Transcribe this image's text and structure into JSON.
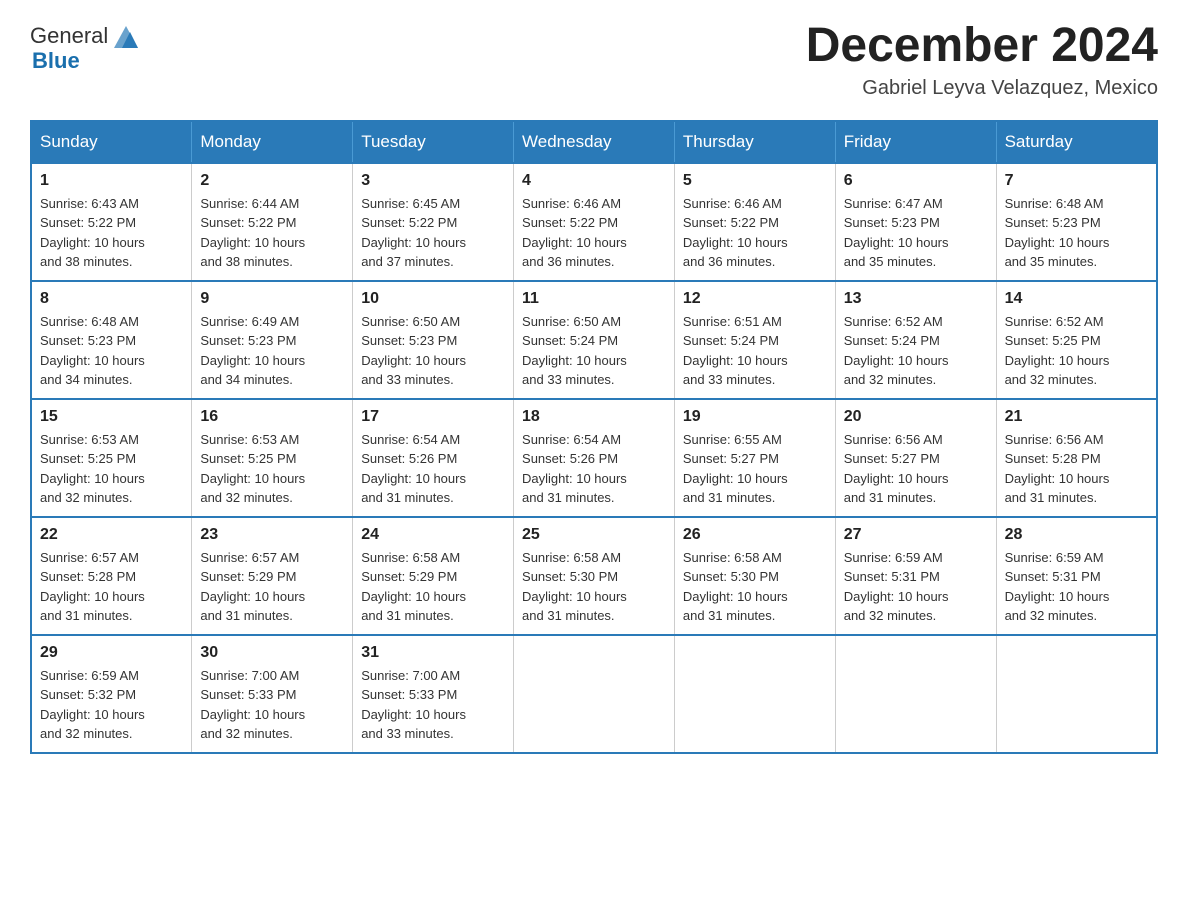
{
  "header": {
    "logo_text": "General",
    "logo_blue": "Blue",
    "month_year": "December 2024",
    "location": "Gabriel Leyva Velazquez, Mexico"
  },
  "weekdays": [
    "Sunday",
    "Monday",
    "Tuesday",
    "Wednesday",
    "Thursday",
    "Friday",
    "Saturday"
  ],
  "weeks": [
    [
      {
        "day": "1",
        "sunrise": "6:43 AM",
        "sunset": "5:22 PM",
        "daylight": "10 hours and 38 minutes."
      },
      {
        "day": "2",
        "sunrise": "6:44 AM",
        "sunset": "5:22 PM",
        "daylight": "10 hours and 38 minutes."
      },
      {
        "day": "3",
        "sunrise": "6:45 AM",
        "sunset": "5:22 PM",
        "daylight": "10 hours and 37 minutes."
      },
      {
        "day": "4",
        "sunrise": "6:46 AM",
        "sunset": "5:22 PM",
        "daylight": "10 hours and 36 minutes."
      },
      {
        "day": "5",
        "sunrise": "6:46 AM",
        "sunset": "5:22 PM",
        "daylight": "10 hours and 36 minutes."
      },
      {
        "day": "6",
        "sunrise": "6:47 AM",
        "sunset": "5:23 PM",
        "daylight": "10 hours and 35 minutes."
      },
      {
        "day": "7",
        "sunrise": "6:48 AM",
        "sunset": "5:23 PM",
        "daylight": "10 hours and 35 minutes."
      }
    ],
    [
      {
        "day": "8",
        "sunrise": "6:48 AM",
        "sunset": "5:23 PM",
        "daylight": "10 hours and 34 minutes."
      },
      {
        "day": "9",
        "sunrise": "6:49 AM",
        "sunset": "5:23 PM",
        "daylight": "10 hours and 34 minutes."
      },
      {
        "day": "10",
        "sunrise": "6:50 AM",
        "sunset": "5:23 PM",
        "daylight": "10 hours and 33 minutes."
      },
      {
        "day": "11",
        "sunrise": "6:50 AM",
        "sunset": "5:24 PM",
        "daylight": "10 hours and 33 minutes."
      },
      {
        "day": "12",
        "sunrise": "6:51 AM",
        "sunset": "5:24 PM",
        "daylight": "10 hours and 33 minutes."
      },
      {
        "day": "13",
        "sunrise": "6:52 AM",
        "sunset": "5:24 PM",
        "daylight": "10 hours and 32 minutes."
      },
      {
        "day": "14",
        "sunrise": "6:52 AM",
        "sunset": "5:25 PM",
        "daylight": "10 hours and 32 minutes."
      }
    ],
    [
      {
        "day": "15",
        "sunrise": "6:53 AM",
        "sunset": "5:25 PM",
        "daylight": "10 hours and 32 minutes."
      },
      {
        "day": "16",
        "sunrise": "6:53 AM",
        "sunset": "5:25 PM",
        "daylight": "10 hours and 32 minutes."
      },
      {
        "day": "17",
        "sunrise": "6:54 AM",
        "sunset": "5:26 PM",
        "daylight": "10 hours and 31 minutes."
      },
      {
        "day": "18",
        "sunrise": "6:54 AM",
        "sunset": "5:26 PM",
        "daylight": "10 hours and 31 minutes."
      },
      {
        "day": "19",
        "sunrise": "6:55 AM",
        "sunset": "5:27 PM",
        "daylight": "10 hours and 31 minutes."
      },
      {
        "day": "20",
        "sunrise": "6:56 AM",
        "sunset": "5:27 PM",
        "daylight": "10 hours and 31 minutes."
      },
      {
        "day": "21",
        "sunrise": "6:56 AM",
        "sunset": "5:28 PM",
        "daylight": "10 hours and 31 minutes."
      }
    ],
    [
      {
        "day": "22",
        "sunrise": "6:57 AM",
        "sunset": "5:28 PM",
        "daylight": "10 hours and 31 minutes."
      },
      {
        "day": "23",
        "sunrise": "6:57 AM",
        "sunset": "5:29 PM",
        "daylight": "10 hours and 31 minutes."
      },
      {
        "day": "24",
        "sunrise": "6:58 AM",
        "sunset": "5:29 PM",
        "daylight": "10 hours and 31 minutes."
      },
      {
        "day": "25",
        "sunrise": "6:58 AM",
        "sunset": "5:30 PM",
        "daylight": "10 hours and 31 minutes."
      },
      {
        "day": "26",
        "sunrise": "6:58 AM",
        "sunset": "5:30 PM",
        "daylight": "10 hours and 31 minutes."
      },
      {
        "day": "27",
        "sunrise": "6:59 AM",
        "sunset": "5:31 PM",
        "daylight": "10 hours and 32 minutes."
      },
      {
        "day": "28",
        "sunrise": "6:59 AM",
        "sunset": "5:31 PM",
        "daylight": "10 hours and 32 minutes."
      }
    ],
    [
      {
        "day": "29",
        "sunrise": "6:59 AM",
        "sunset": "5:32 PM",
        "daylight": "10 hours and 32 minutes."
      },
      {
        "day": "30",
        "sunrise": "7:00 AM",
        "sunset": "5:33 PM",
        "daylight": "10 hours and 32 minutes."
      },
      {
        "day": "31",
        "sunrise": "7:00 AM",
        "sunset": "5:33 PM",
        "daylight": "10 hours and 33 minutes."
      },
      null,
      null,
      null,
      null
    ]
  ],
  "labels": {
    "sunrise": "Sunrise:",
    "sunset": "Sunset:",
    "daylight": "Daylight:"
  }
}
